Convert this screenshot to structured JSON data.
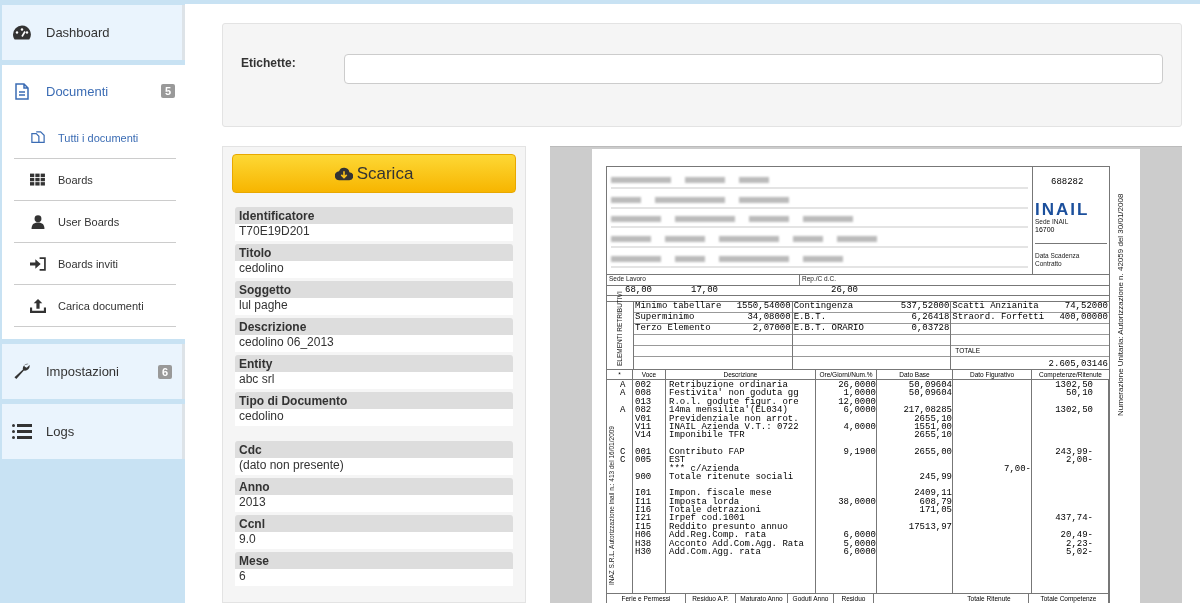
{
  "sidebar": {
    "items": [
      {
        "label": "Dashboard",
        "expanded": false
      },
      {
        "label": "Documenti",
        "badge": "5",
        "expanded": true,
        "children": [
          {
            "label": "Tutti i documenti",
            "selected": true
          },
          {
            "label": "Boards",
            "selected": false
          },
          {
            "label": "User Boards",
            "selected": false
          },
          {
            "label": "Boards inviti",
            "selected": false
          },
          {
            "label": "Carica documenti",
            "selected": false
          }
        ]
      },
      {
        "label": "Impostazioni",
        "badge": "6",
        "expanded": false
      },
      {
        "label": "Logs",
        "expanded": false
      }
    ]
  },
  "tags": {
    "label": "Etichette:"
  },
  "download_button": "Scarica",
  "field_groups": [
    [
      {
        "label": "Identificatore",
        "value": "T70E19D201"
      },
      {
        "label": "Titolo",
        "value": "cedolino"
      },
      {
        "label": "Soggetto",
        "value": "lul paghe"
      },
      {
        "label": "Descrizione",
        "value": "cedolino 06_2013"
      },
      {
        "label": "Entity",
        "value": "abc srl"
      },
      {
        "label": "Tipo di Documento",
        "value": "cedolino"
      }
    ],
    [
      {
        "label": "Cdc",
        "value": "(dato non presente)"
      },
      {
        "label": "Anno",
        "value": "2013"
      },
      {
        "label": "Ccnl",
        "value": "9.0"
      },
      {
        "label": "Mese",
        "value": "6"
      }
    ]
  ],
  "payslip": {
    "number": "688282",
    "logo": "INAIL",
    "sede_label": "Sede INAIL",
    "sede": "16700",
    "contract_label": "Data Scadenza Contratto",
    "work_site_label": "Sede Lavoro",
    "rep_label": "Rep./C d.C.",
    "hours": [
      "68,00",
      "17,00",
      "26,00"
    ],
    "elements_label": "ELEMENTI RETRIBUTIVI",
    "elements": [
      [
        {
          "name": "Minimo tabellare",
          "value": "1550,54000"
        },
        {
          "name": "Superminimo",
          "value": "34,08000"
        },
        {
          "name": "Terzo Elemento",
          "value": "2,07000"
        }
      ],
      [
        {
          "name": "Contingenza",
          "value": "537,52000"
        },
        {
          "name": "E.B.T.",
          "value": "6,26418"
        },
        {
          "name": "E.B.T. ORARIO",
          "value": "0,03728"
        }
      ],
      [
        {
          "name": "Scatti Anzianita",
          "value": "74,52000"
        },
        {
          "name": "Straord. Forfetti",
          "value": "400,00000"
        }
      ]
    ],
    "total_label": "TOTALE",
    "total": "2.605,03146",
    "columns": [
      "*",
      "Voce",
      "Descrizione",
      "Ore/Giorni/Num.%",
      "Dato Base",
      "Dato Figurativo",
      "Competenze/Ritenute"
    ],
    "row_groups": [
      [
        {
          "flag": "A",
          "code": "002",
          "desc": "Retribuzione ordinaria",
          "qty": "26,0000",
          "base": "50,09604",
          "amt": "1302,50"
        },
        {
          "flag": "A",
          "code": "008",
          "desc": "Festivita'  non goduta gg",
          "qty": "1,0000",
          "base": "50,09604",
          "amt": "50,10"
        },
        {
          "code": "013",
          "desc": "R.o.l. godute figur. ore",
          "qty": "12,0000"
        },
        {
          "flag": "A",
          "code": "082",
          "desc": "14ma mensilita'(EL034)",
          "qty": "6,0000",
          "base": "217,08285",
          "amt": "1302,50"
        },
        {
          "code": "V01",
          "desc": "Previdenziale non arrot.",
          "base": "2655,10"
        },
        {
          "code": "V11",
          "desc": "INAIL Azienda V.T.: 0722",
          "qty": "4,0000",
          "base": "1551,00"
        },
        {
          "code": "V14",
          "desc": "Imponibile TFR",
          "base": "2655,10"
        }
      ],
      [
        {
          "flag": "C",
          "code": "001",
          "desc": "Contributo FAP",
          "qty": "9,1900",
          "base": "2655,00",
          "amt": "243,99-"
        },
        {
          "flag": "C",
          "code": "005",
          "desc": "EST",
          "amt": "2,00-"
        },
        {
          "desc": "*** c/Azienda",
          "fig": "7,00-"
        },
        {
          "code": "900",
          "desc": "Totale ritenute sociali",
          "base": "245,99"
        }
      ],
      [
        {
          "code": "I01",
          "desc": "Impon. fiscale mese",
          "base": "2409,11"
        },
        {
          "code": "I11",
          "desc": "Imposta lorda",
          "qty": "38,0000",
          "base": "608,79"
        },
        {
          "code": "I16",
          "desc": "Totale detrazioni",
          "base": "171,05"
        },
        {
          "code": "I21",
          "desc": "Irpef cod.1001",
          "amt": "437,74-"
        },
        {
          "code": "I15",
          "desc": "Reddito presunto annuo",
          "base": "17513,97"
        },
        {
          "code": "H06",
          "desc": "Add.Reg.Comp. rata",
          "qty": "6,0000",
          "amt": "20,49-"
        },
        {
          "code": "H38",
          "desc": "Acconto Add.Com.Agg. Rata",
          "qty": "5,0000",
          "amt": "2,23-"
        },
        {
          "code": "H30",
          "desc": "Add.Com.Agg. rata",
          "qty": "6,0000",
          "amt": "5,02-"
        }
      ]
    ],
    "footer": [
      "Ferie e Permessi",
      "Residuo A.P.",
      "Maturato Anno",
      "Goduti Anno",
      "Residuo",
      "Totale Ritenute",
      "Totale Competenze"
    ],
    "left_note": "INAZ S.R.L. Autorizzazione Inail n.: 413 del 16/01/2009",
    "right_note": "Numerazione Unitaria: Autorizzazione n. 42059 del 30/01/2008"
  }
}
